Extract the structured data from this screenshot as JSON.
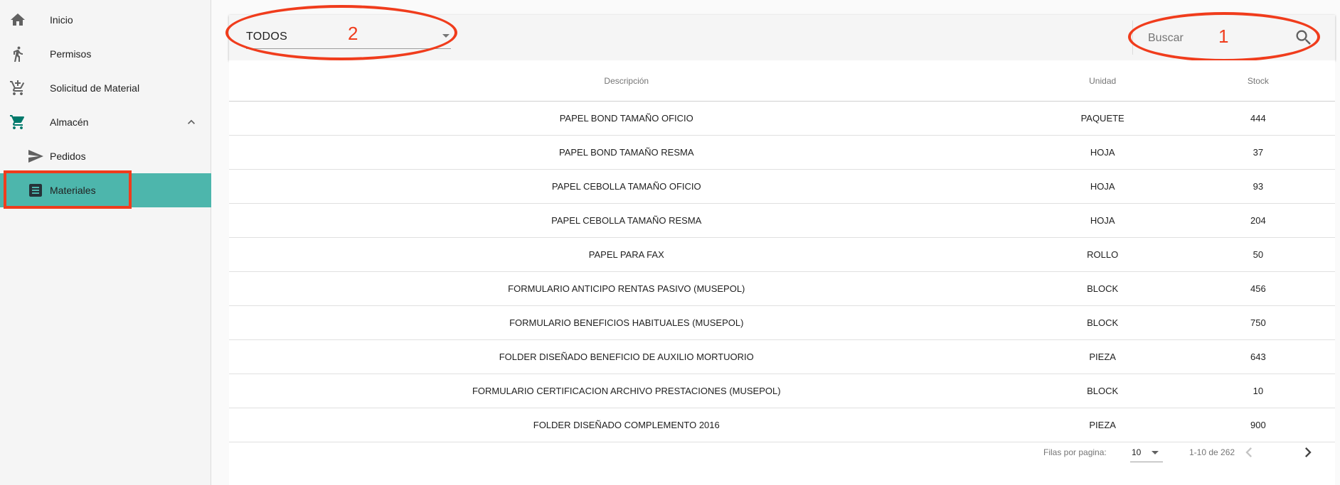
{
  "sidebar": {
    "items": [
      {
        "label": "Inicio",
        "icon": "home-icon"
      },
      {
        "label": "Permisos",
        "icon": "run-icon"
      },
      {
        "label": "Solicitud de Material",
        "icon": "add-cart-icon"
      },
      {
        "label": "Almacén",
        "icon": "cart-icon",
        "expanded": true
      },
      {
        "label": "Pedidos",
        "icon": "send-icon"
      },
      {
        "label": "Materiales",
        "icon": "list-icon",
        "active": true
      }
    ]
  },
  "filter": {
    "selected": "TODOS"
  },
  "search": {
    "placeholder": "Buscar"
  },
  "annotations": {
    "search_number": "1",
    "filter_number": "2",
    "color": "#f03c1c"
  },
  "table": {
    "headers": [
      "Descripción",
      "Unidad",
      "Stock"
    ],
    "rows": [
      [
        "PAPEL BOND TAMAÑO OFICIO",
        "PAQUETE",
        "444"
      ],
      [
        "PAPEL BOND TAMAÑO RESMA",
        "HOJA",
        "37"
      ],
      [
        "PAPEL CEBOLLA TAMAÑO OFICIO",
        "HOJA",
        "93"
      ],
      [
        "PAPEL CEBOLLA TAMAÑO RESMA",
        "HOJA",
        "204"
      ],
      [
        "PAPEL PARA FAX",
        "ROLLO",
        "50"
      ],
      [
        "FORMULARIO ANTICIPO RENTAS PASIVO (MUSEPOL)",
        "BLOCK",
        "456"
      ],
      [
        "FORMULARIO BENEFICIOS HABITUALES (MUSEPOL)",
        "BLOCK",
        "750"
      ],
      [
        "FOLDER DISEÑADO BENEFICIO DE AUXILIO MORTUORIO",
        "PIEZA",
        "643"
      ],
      [
        "FORMULARIO CERTIFICACION ARCHIVO PRESTACIONES (MUSEPOL)",
        "BLOCK",
        "10"
      ],
      [
        "FOLDER DISEÑADO COMPLEMENTO 2016",
        "PIEZA",
        "900"
      ]
    ]
  },
  "pagination": {
    "rows_label": "Filas por pagina:",
    "rows_per_page": "10",
    "range": "1-10 de 262"
  },
  "colors": {
    "active_item": "#4db6ac",
    "cart_icon": "#00796b"
  }
}
